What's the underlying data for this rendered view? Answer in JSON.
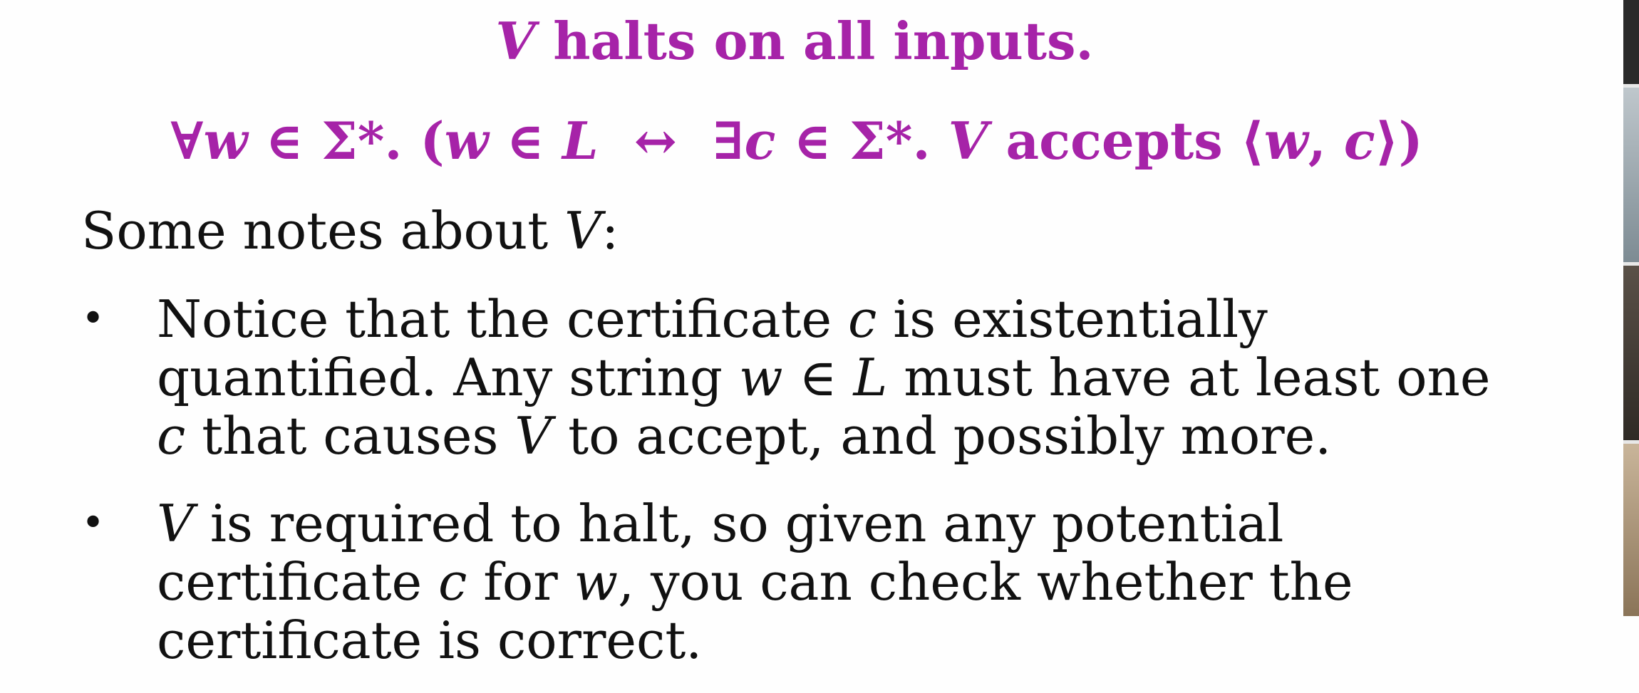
{
  "slide": {
    "heading1": {
      "var": "V",
      "rest": " halts on all inputs."
    },
    "heading2": {
      "part1": "∀",
      "w1": "w",
      "part2": " ∈ Σ*. (",
      "w2": "w",
      "part3": " ∈ ",
      "L": "L",
      "arrow": "↔",
      "part4": "∃",
      "c1": "c",
      "part5": " ∈ Σ*. ",
      "V": "V",
      "part6": " accepts ⟨",
      "w3": "w",
      "part7": ", ",
      "c2": "c",
      "part8": "⟩)"
    },
    "intro": {
      "text": "Some notes about ",
      "var": "V",
      "colon": ":"
    },
    "bullets": [
      {
        "symbol": "•",
        "l1a": "Notice that the certificate ",
        "l1c": "c",
        "l1b": " is existentially",
        "l2a": "quantified. Any string ",
        "l2w": "w",
        "l2b": " ∈ ",
        "l2L": "L",
        "l2c": " must have at least one",
        "l3c": "c",
        "l3a": " that causes ",
        "l3V": "V",
        "l3b": " to accept, and possibly more."
      },
      {
        "symbol": "•",
        "l1V": "V",
        "l1a": " is required to halt, so given any potential",
        "l2a": "certificate ",
        "l2c": "c",
        "l2b": " for ",
        "l2w": "w",
        "l2d": ", you can check whether the",
        "l3a": "certificate is correct."
      }
    ]
  },
  "colors": {
    "heading": "#a623a8",
    "text": "#111111",
    "background": "#fefefe"
  }
}
